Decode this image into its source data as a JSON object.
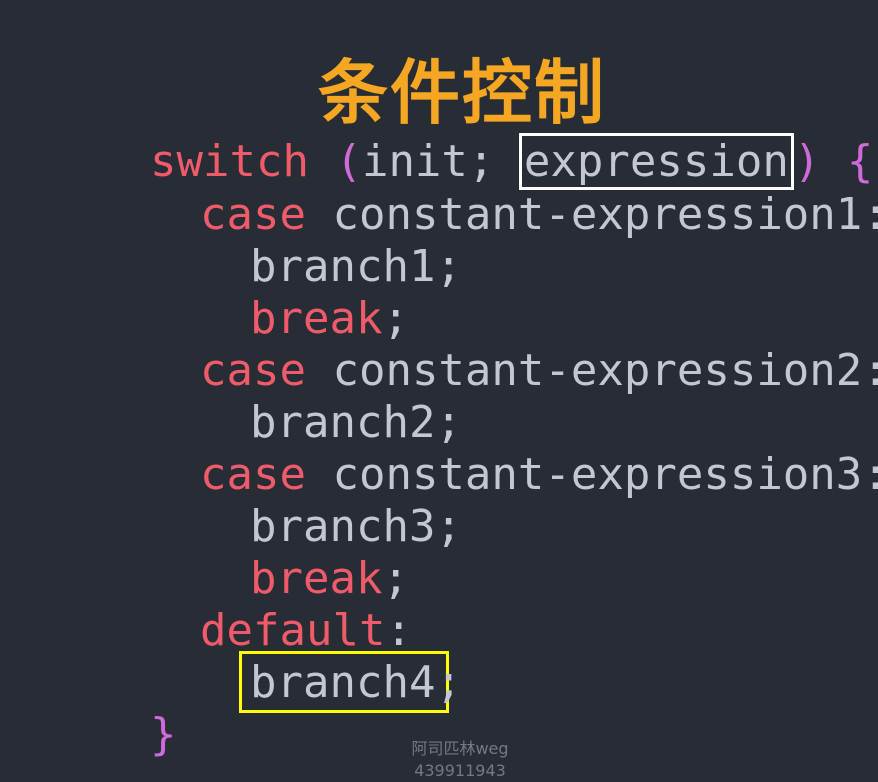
{
  "slide": {
    "title": "条件控制"
  },
  "code": {
    "line1": {
      "keyword": "switch",
      "open_paren": "(",
      "init": "init; ",
      "expression": "expression",
      "close_paren": ")",
      "brace": "{"
    },
    "case1": {
      "keyword": "case",
      "label": "constant-expression1:",
      "branch": "branch1;",
      "break_kw": "break",
      "semicolon": ";"
    },
    "case2": {
      "keyword": "case",
      "label": "constant-expression2:",
      "branch": "branch2;"
    },
    "case3": {
      "keyword": "case",
      "label": "constant-expression3:",
      "branch": "branch3;",
      "break_kw": "break",
      "semicolon": ";"
    },
    "default": {
      "keyword": "default",
      "colon": ":",
      "branch": "branch4;"
    },
    "closing_brace": "}"
  },
  "watermark": {
    "line1": "阿司匹林weg",
    "line2": "439911943"
  },
  "colors": {
    "background": "#282c34",
    "title": "#f5a623",
    "keyword": "#ef5b6b",
    "bracket": "#d16ad9",
    "text": "#c3c7cf",
    "highlight_white": "#ffffff",
    "highlight_yellow": "#ffff00"
  }
}
